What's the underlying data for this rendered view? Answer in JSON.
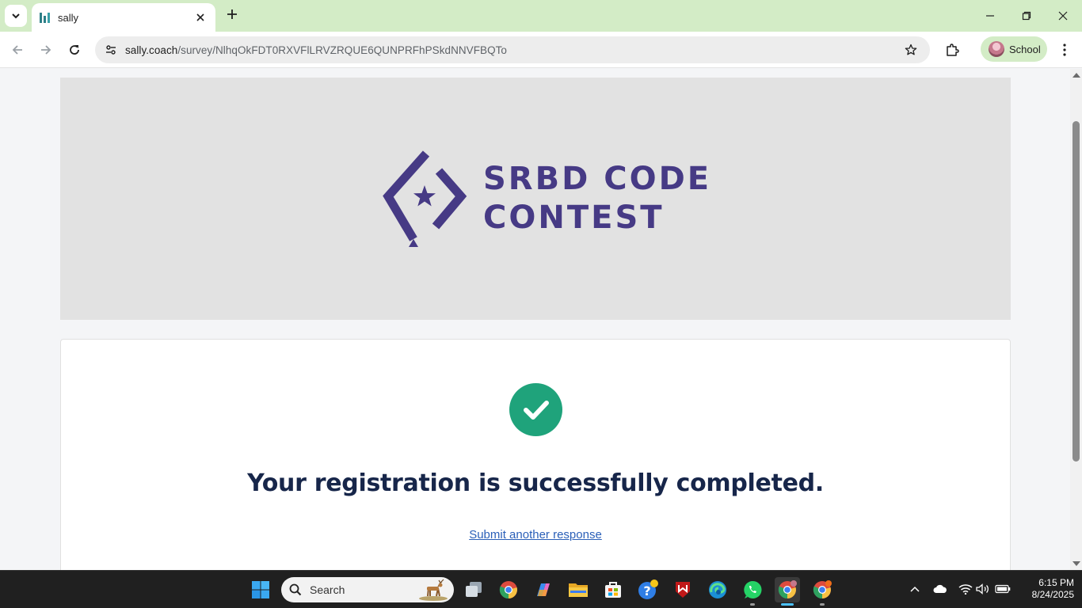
{
  "browser": {
    "tab": {
      "title": "sally",
      "favicon": "bar-chart-icon"
    },
    "url": {
      "host": "sally.coach",
      "path": "/survey/NlhqOkFDT0RXVFlLRVZRQUE6QUNPRFhPSkdNNVFBQTo"
    },
    "profile": {
      "label": "School"
    }
  },
  "page": {
    "banner": {
      "logo_line1": "SRBD CODE",
      "logo_line2": "CONTEST",
      "logo_color": "#463a85"
    },
    "success": {
      "message": "Your registration is successfully completed.",
      "link": "Submit another response",
      "check_color": "#1fa37b"
    }
  },
  "taskbar": {
    "search_label": "Search",
    "time": "6:15 PM",
    "date": "8/24/2025"
  }
}
